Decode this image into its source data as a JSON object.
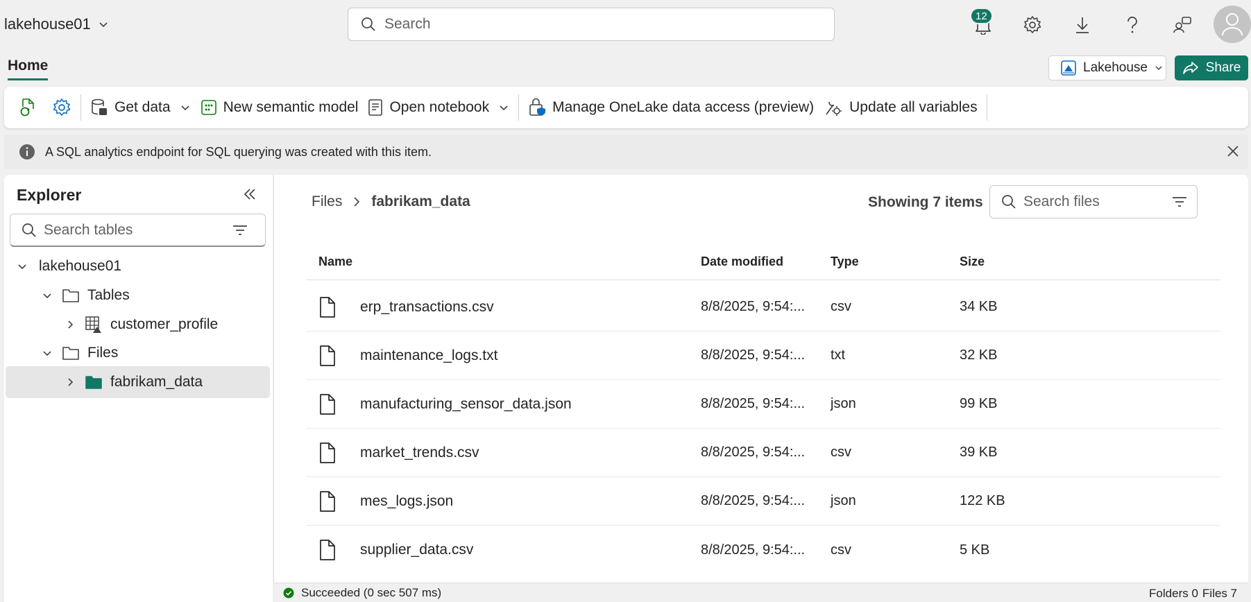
{
  "topbar": {
    "workspace": "lakehouse01",
    "search_placeholder": "Search",
    "notification_count": "12"
  },
  "home_tab": "Home",
  "lakehouse_switch": "Lakehouse",
  "share_label": "Share",
  "ribbon": {
    "get_data": "Get data",
    "new_semantic_model": "New semantic model",
    "open_notebook": "Open notebook",
    "manage_access": "Manage OneLake data access (preview)",
    "update_vars": "Update all variables"
  },
  "info_message": "A SQL analytics endpoint for SQL querying was created with this item.",
  "explorer": {
    "title": "Explorer",
    "search_placeholder": "Search tables",
    "tree": {
      "root": "lakehouse01",
      "tables": "Tables",
      "customer_profile": "customer_profile",
      "files": "Files",
      "fabrikam_data": "fabrikam_data"
    }
  },
  "main": {
    "breadcrumb_root": "Files",
    "breadcrumb_current": "fabrikam_data",
    "item_count": "Showing 7 items",
    "search_placeholder": "Search files",
    "columns": {
      "name": "Name",
      "date": "Date modified",
      "type": "Type",
      "size": "Size"
    },
    "files": [
      {
        "name": "erp_transactions.csv",
        "date": "8/8/2025, 9:54:...",
        "type": "csv",
        "size": "34 KB"
      },
      {
        "name": "maintenance_logs.txt",
        "date": "8/8/2025, 9:54:...",
        "type": "txt",
        "size": "32 KB"
      },
      {
        "name": "manufacturing_sensor_data.json",
        "date": "8/8/2025, 9:54:...",
        "type": "json",
        "size": "99 KB"
      },
      {
        "name": "market_trends.csv",
        "date": "8/8/2025, 9:54:...",
        "type": "csv",
        "size": "39 KB"
      },
      {
        "name": "mes_logs.json",
        "date": "8/8/2025, 9:54:...",
        "type": "json",
        "size": "122 KB"
      },
      {
        "name": "supplier_data.csv",
        "date": "8/8/2025, 9:54:...",
        "type": "csv",
        "size": "5 KB"
      }
    ]
  },
  "status": {
    "message": "Succeeded (0 sec 507 ms)",
    "folders": "Folders 0",
    "files": "Files 7"
  },
  "colors": {
    "accent": "#117865",
    "success": "#107c10"
  }
}
